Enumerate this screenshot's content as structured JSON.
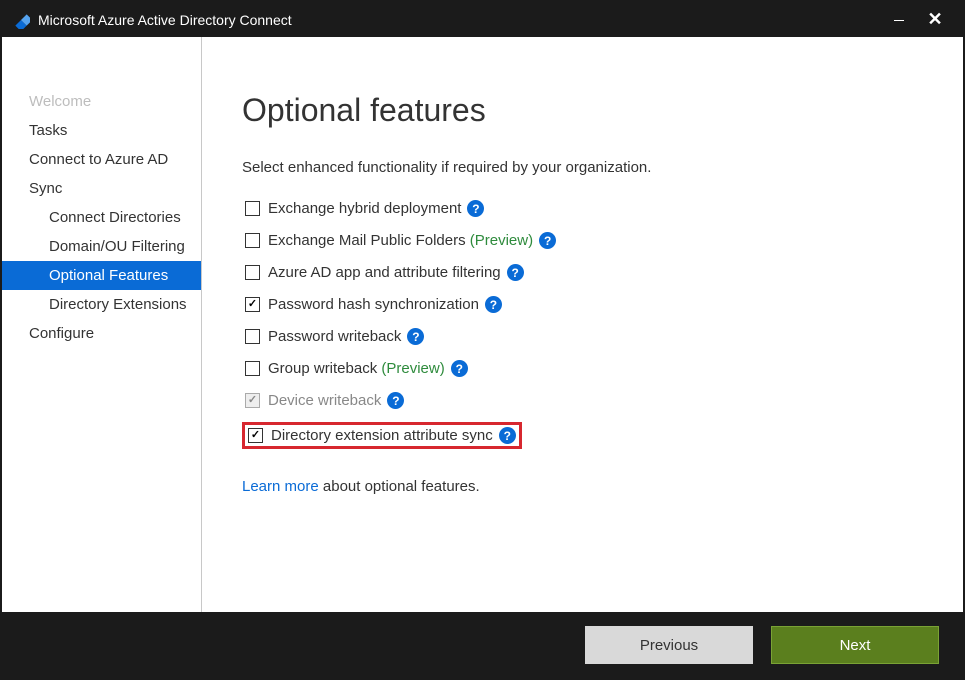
{
  "window": {
    "title": "Microsoft Azure Active Directory Connect"
  },
  "sidebar": {
    "items": [
      {
        "label": "Welcome",
        "level": "top",
        "muted": true,
        "active": false
      },
      {
        "label": "Tasks",
        "level": "top",
        "muted": false,
        "active": false
      },
      {
        "label": "Connect to Azure AD",
        "level": "top",
        "muted": false,
        "active": false
      },
      {
        "label": "Sync",
        "level": "top",
        "muted": false,
        "active": false
      },
      {
        "label": "Connect Directories",
        "level": "sub",
        "muted": false,
        "active": false
      },
      {
        "label": "Domain/OU Filtering",
        "level": "sub",
        "muted": false,
        "active": false
      },
      {
        "label": "Optional Features",
        "level": "sub",
        "muted": false,
        "active": true
      },
      {
        "label": "Directory Extensions",
        "level": "sub",
        "muted": false,
        "active": false
      },
      {
        "label": "Configure",
        "level": "top",
        "muted": false,
        "active": false
      }
    ]
  },
  "page": {
    "heading": "Optional features",
    "subtitle": "Select enhanced functionality if required by your organization."
  },
  "features": [
    {
      "label": "Exchange hybrid deployment",
      "preview": "",
      "checked": false,
      "disabled": false,
      "highlight": false
    },
    {
      "label": "Exchange Mail Public Folders",
      "preview": " (Preview)",
      "checked": false,
      "disabled": false,
      "highlight": false
    },
    {
      "label": "Azure AD app and attribute filtering",
      "preview": "",
      "checked": false,
      "disabled": false,
      "highlight": false
    },
    {
      "label": "Password hash synchronization",
      "preview": "",
      "checked": true,
      "disabled": false,
      "highlight": false
    },
    {
      "label": "Password writeback",
      "preview": "",
      "checked": false,
      "disabled": false,
      "highlight": false
    },
    {
      "label": "Group writeback",
      "preview": " (Preview)",
      "checked": false,
      "disabled": false,
      "highlight": false
    },
    {
      "label": "Device writeback",
      "preview": "",
      "checked": true,
      "disabled": true,
      "highlight": false
    },
    {
      "label": "Directory extension attribute sync",
      "preview": "",
      "checked": true,
      "disabled": false,
      "highlight": true
    }
  ],
  "learn": {
    "link_text": "Learn more",
    "rest_text": " about optional features."
  },
  "footer": {
    "previous": "Previous",
    "next": "Next"
  }
}
